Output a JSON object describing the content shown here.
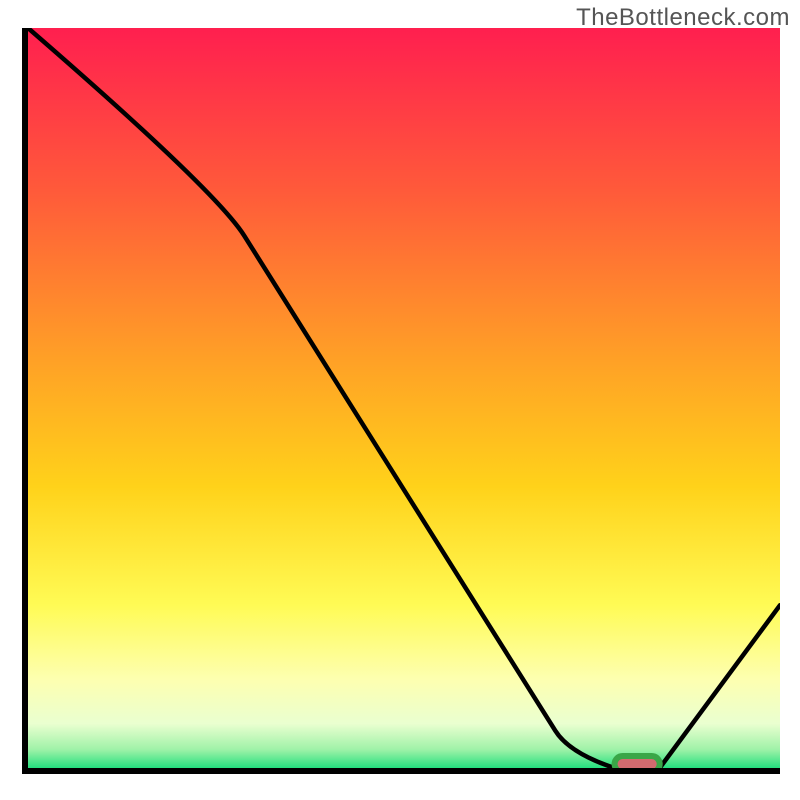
{
  "watermark": "TheBottleneck.com",
  "colors": {
    "axis": "#000000",
    "curve": "#000000",
    "marker_fill": "#d36a6f",
    "marker_stroke": "#3aa648",
    "gradient_stops": [
      {
        "offset": 0.0,
        "color": "#ff1f4f"
      },
      {
        "offset": 0.22,
        "color": "#ff5a3a"
      },
      {
        "offset": 0.45,
        "color": "#ffa126"
      },
      {
        "offset": 0.62,
        "color": "#ffd21a"
      },
      {
        "offset": 0.78,
        "color": "#fffb55"
      },
      {
        "offset": 0.88,
        "color": "#fdffb0"
      },
      {
        "offset": 0.94,
        "color": "#eaffd0"
      },
      {
        "offset": 0.975,
        "color": "#9ff2a8"
      },
      {
        "offset": 1.0,
        "color": "#24e07e"
      }
    ]
  },
  "chart_data": {
    "type": "line",
    "title": "",
    "xlabel": "",
    "ylabel": "",
    "xlim": [
      0,
      100
    ],
    "ylim": [
      0,
      100
    ],
    "x": [
      0,
      25,
      72,
      78,
      84,
      100
    ],
    "y": [
      100,
      78,
      2,
      0,
      0,
      22
    ],
    "marker_segment": {
      "x0": 78,
      "x1": 84,
      "y": 0
    }
  }
}
